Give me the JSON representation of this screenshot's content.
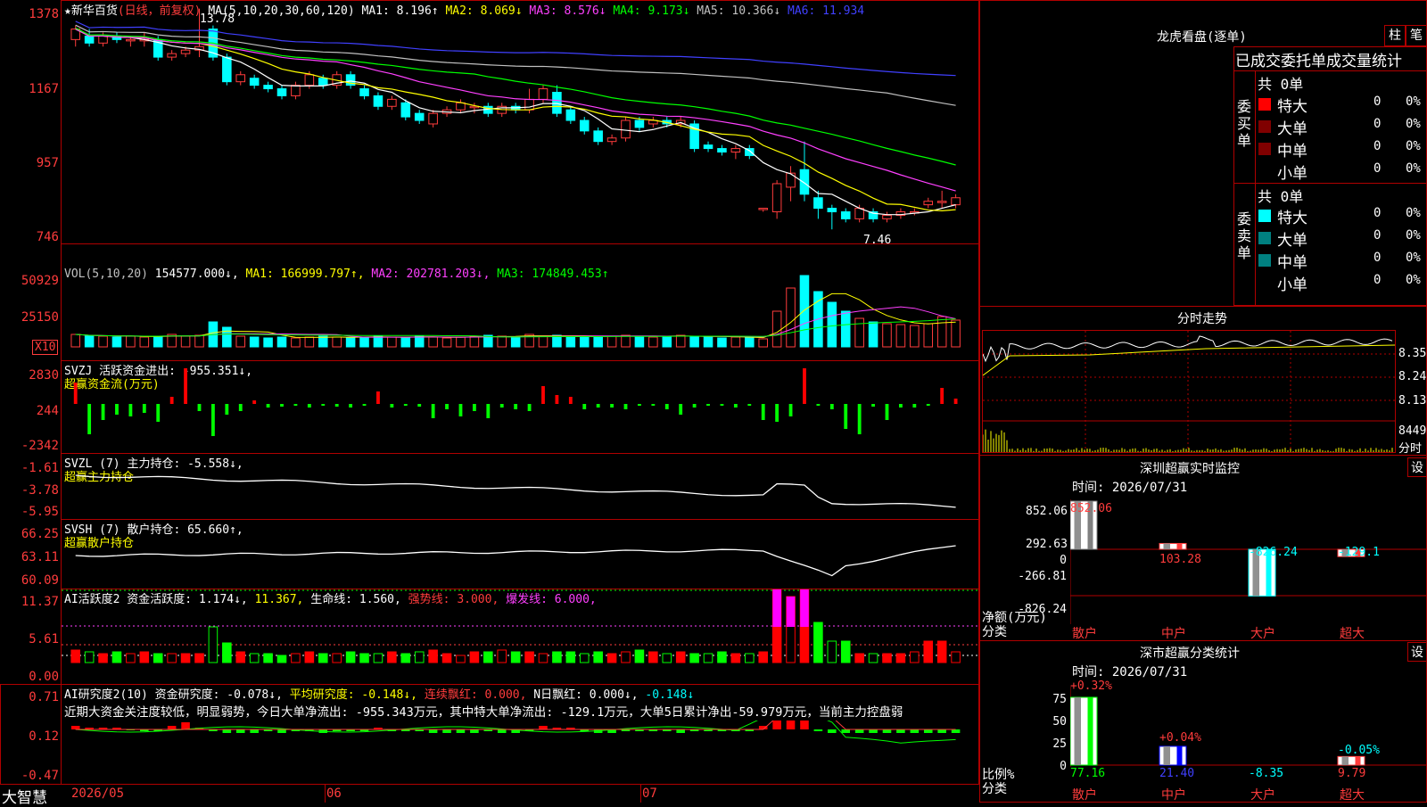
{
  "main": {
    "title": "★新华百货",
    "period": "(日线，前复权)",
    "ma_label": "MA(5,10,20,30,60,120)",
    "ma": [
      {
        "label": "MA1:",
        "value": "8.196↑",
        "color": "#ffffff"
      },
      {
        "label": "MA2:",
        "value": "8.069↓",
        "color": "#ffff00"
      },
      {
        "label": "MA3:",
        "value": "8.576↓",
        "color": "#ff40ff"
      },
      {
        "label": "MA4:",
        "value": "9.173↓",
        "color": "#00ff00"
      },
      {
        "label": "MA5:",
        "value": "10.366↓",
        "color": "#c0c0c0"
      },
      {
        "label": "MA6:",
        "value": "11.934",
        "color": "#4040ff"
      }
    ],
    "high_mark": "13.78",
    "low_mark": "7.46",
    "yticks": [
      "1378",
      "1167",
      "957",
      "746"
    ],
    "candles": [
      [
        12.9,
        13.2,
        12.7,
        13.3
      ],
      [
        13.0,
        12.8,
        12.7,
        13.2
      ],
      [
        12.8,
        13.0,
        12.7,
        13.1
      ],
      [
        13.0,
        12.9,
        12.8,
        13.1
      ],
      [
        12.9,
        12.9,
        12.7,
        13.0
      ],
      [
        12.9,
        12.9,
        12.7,
        13.1
      ],
      [
        12.9,
        12.4,
        12.3,
        13.0
      ],
      [
        12.4,
        12.5,
        12.3,
        12.6
      ],
      [
        12.5,
        12.6,
        12.4,
        12.7
      ],
      [
        12.6,
        12.7,
        12.4,
        13.78
      ],
      [
        13.2,
        12.4,
        12.3,
        13.3
      ],
      [
        12.4,
        11.7,
        11.6,
        12.5
      ],
      [
        11.7,
        11.9,
        11.6,
        12.0
      ],
      [
        11.8,
        11.6,
        11.5,
        11.9
      ],
      [
        11.6,
        11.5,
        11.4,
        11.7
      ],
      [
        11.5,
        11.3,
        11.2,
        11.6
      ],
      [
        11.3,
        11.6,
        11.2,
        11.7
      ],
      [
        11.6,
        11.9,
        11.5,
        12.0
      ],
      [
        11.8,
        11.6,
        11.5,
        11.9
      ],
      [
        11.6,
        11.9,
        11.5,
        12.0
      ],
      [
        11.9,
        11.6,
        11.5,
        12.0
      ],
      [
        11.5,
        11.3,
        11.2,
        11.6
      ],
      [
        11.3,
        11.0,
        10.9,
        11.4
      ],
      [
        11.0,
        11.2,
        10.9,
        11.3
      ],
      [
        11.1,
        10.7,
        10.6,
        11.2
      ],
      [
        10.8,
        10.6,
        10.5,
        10.9
      ],
      [
        10.5,
        10.8,
        10.4,
        10.9
      ],
      [
        10.8,
        10.9,
        10.7,
        11.0
      ],
      [
        10.9,
        11.1,
        10.8,
        11.2
      ],
      [
        11.0,
        11.0,
        10.8,
        11.1
      ],
      [
        11.0,
        10.8,
        10.7,
        11.1
      ],
      [
        10.8,
        11.0,
        10.7,
        11.1
      ],
      [
        11.0,
        10.9,
        10.8,
        11.1
      ],
      [
        10.9,
        11.2,
        10.8,
        11.5
      ],
      [
        11.2,
        11.5,
        11.1,
        11.6
      ],
      [
        11.4,
        10.8,
        10.7,
        11.6
      ],
      [
        10.9,
        10.6,
        10.5,
        11.0
      ],
      [
        10.6,
        10.3,
        10.2,
        10.7
      ],
      [
        10.3,
        10.0,
        9.9,
        10.4
      ],
      [
        10.0,
        10.1,
        9.9,
        10.2
      ],
      [
        10.1,
        10.6,
        10.0,
        10.7
      ],
      [
        10.6,
        10.4,
        10.3,
        10.7
      ],
      [
        10.5,
        10.6,
        10.4,
        10.7
      ],
      [
        10.6,
        10.5,
        10.4,
        10.7
      ],
      [
        10.5,
        10.6,
        10.4,
        10.7
      ],
      [
        10.5,
        9.8,
        9.7,
        10.6
      ],
      [
        9.9,
        9.8,
        9.7,
        10.0
      ],
      [
        9.8,
        9.7,
        9.6,
        9.9
      ],
      [
        9.7,
        9.8,
        9.5,
        9.9
      ],
      [
        9.8,
        9.6,
        9.5,
        9.9
      ],
      [
        8.1,
        8.1,
        8.0,
        8.1
      ],
      [
        8.0,
        8.8,
        7.8,
        8.9
      ],
      [
        8.7,
        9.1,
        8.3,
        9.3
      ],
      [
        9.2,
        8.5,
        8.3,
        10.0
      ],
      [
        8.4,
        8.1,
        7.8,
        8.6
      ],
      [
        8.1,
        8.0,
        7.5,
        8.2
      ],
      [
        8.0,
        7.8,
        7.7,
        8.1
      ],
      [
        7.8,
        8.1,
        7.7,
        8.2
      ],
      [
        8.0,
        7.8,
        7.7,
        8.1
      ],
      [
        7.8,
        7.9,
        7.7,
        8.0
      ],
      [
        7.9,
        8.0,
        7.8,
        8.1
      ],
      [
        8.0,
        8.0,
        7.9,
        8.1
      ],
      [
        8.2,
        8.3,
        8.1,
        8.4
      ],
      [
        8.3,
        8.3,
        8.1,
        8.6
      ],
      [
        8.2,
        8.4,
        8.1,
        8.5
      ]
    ]
  },
  "vol": {
    "label": "VOL(5,10,20)",
    "value": "154577.000↓,",
    "ma": [
      {
        "label": "MA1:",
        "value": "166999.797↑,",
        "color": "#ffff00"
      },
      {
        "label": "MA2:",
        "value": "202781.203↓,",
        "color": "#ff40ff"
      },
      {
        "label": "MA3:",
        "value": "174849.453↑",
        "color": "#00ff00"
      }
    ],
    "yticks": [
      "50929",
      "25150"
    ],
    "unit": "X10"
  },
  "svzj": {
    "label": "SVZJ  活跃资金进出:",
    "value": "-955.351↓,",
    "subtitle": "超赢资金流(万元)",
    "yticks": [
      "2830",
      "244",
      "-2342"
    ]
  },
  "svzl": {
    "label": "SVZL (7) 主力持仓:",
    "value": "-5.558↓,",
    "subtitle": "超赢主力持仓",
    "yticks": [
      "-1.61",
      "-3.78",
      "-5.95"
    ]
  },
  "svsh": {
    "label": "SVSH (7) 散户持仓:",
    "value": "65.660↑,",
    "subtitle": "超赢散户持仓",
    "yticks": [
      "66.25",
      "63.11",
      "60.09"
    ]
  },
  "ai1": {
    "title": "AI活跃度2 资金活跃度:",
    "value1": "1.174↓,",
    "value2": "11.367,",
    "life": "生命线: 1.560,",
    "strong": "强势线: 3.000,",
    "burst": "爆发线: 6.000,",
    "yticks": [
      "11.37",
      "5.61",
      "0.00"
    ]
  },
  "ai2": {
    "title": "AI研究度2(10) 资金研究度:",
    "value1": "-0.078↓,",
    "avg": "平均研究度: -0.148↓,",
    "red": "连续飘红: 0.000,",
    "nred": "N日飘红: 0.000↓,",
    "last": "-0.148↓",
    "text": "近期大资金关注度较低，明显弱势，今日大单净流出: -955.343万元，其中特大单净流出: -129.1万元，大单5日累计净出-59.979万元，当前主力控盘弱",
    "yticks": [
      "0.71",
      "0.12",
      "-0.47"
    ]
  },
  "dates": [
    "2026/05",
    "06",
    "07"
  ],
  "brand": "大智慧",
  "lhb": {
    "title": "龙虎看盘(逐单)",
    "btn1": "柱",
    "btn2": "笔",
    "header": "已成交委托单成交量统计",
    "buy_side": "委买单",
    "sell_side": "委卖单",
    "buy_total": "共 0单",
    "sell_total": "共 0单",
    "rows": [
      "特大",
      "大单",
      "中单",
      "小单"
    ],
    "buy_colors": [
      "#ff0000",
      "#800000",
      "#800000",
      "#000000"
    ],
    "sell_colors": [
      "#00ffff",
      "#008080",
      "#008080",
      "#000000"
    ],
    "zero": "0",
    "pct": "0%"
  },
  "fenshi": {
    "title": "分时走势",
    "yticks": [
      "8.35",
      "8.24",
      "8.13"
    ],
    "vol": "8449",
    "vol_unit": "分时"
  },
  "sz_monitor": {
    "title": "深圳超赢实时监控",
    "btn": "设",
    "time": "时间: 2026/07/31",
    "yticks": [
      "852.06",
      "292.63",
      "0",
      "-266.81",
      "-826.24"
    ],
    "ylabel1": "净额(万元)",
    "ylabel2": "分类",
    "cats": [
      "散户",
      "中户",
      "大户",
      "超大"
    ],
    "vals": [
      "852.06",
      "103.28",
      "-826.24",
      "-129.1"
    ]
  },
  "sz_class": {
    "title": "深市超赢分类统计",
    "btn": "设",
    "time": "时间: 2026/07/31",
    "yticks": [
      "75",
      "50",
      "25",
      "0"
    ],
    "ylabel1": "比例%",
    "ylabel2": "分类",
    "cats": [
      "散户",
      "中户",
      "大户",
      "超大"
    ],
    "top": [
      "+0.32%",
      "+0.04%",
      "",
      "-0.05%"
    ],
    "vals": [
      "77.16",
      "21.40",
      "-8.35",
      "9.79"
    ]
  }
}
